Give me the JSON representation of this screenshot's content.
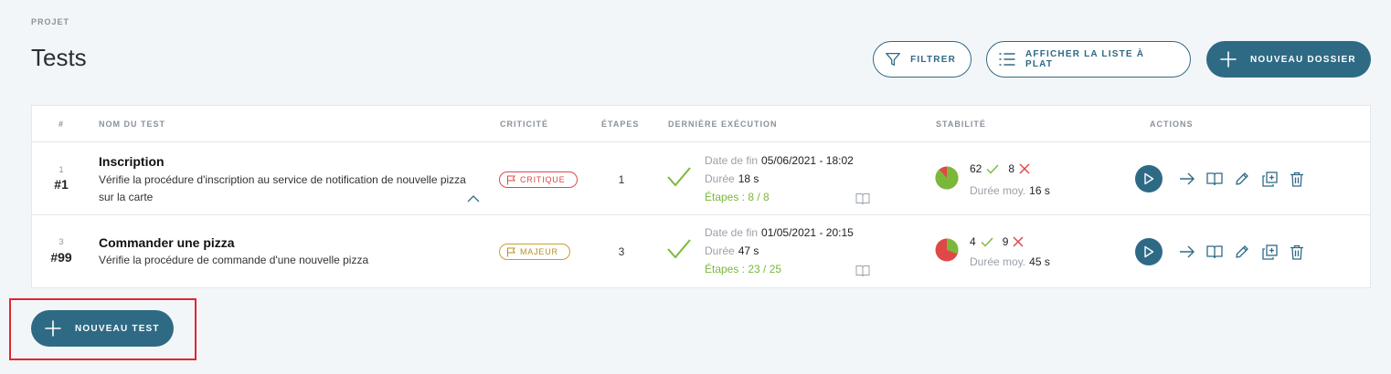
{
  "breadcrumb": "PROJET",
  "title": "Tests",
  "toolbar": {
    "filter_label": "FILTRER",
    "flat_label": "AFFICHER LA LISTE À PLAT",
    "new_folder_label": "NOUVEAU DOSSIER"
  },
  "table": {
    "headers": {
      "index": "#",
      "name": "NOM DU TEST",
      "criticality": "CRITICITÉ",
      "steps": "ÉTAPES",
      "last_execution": "DERNIÈRE EXÉCUTION",
      "stability": "STABILITÉ",
      "actions": "ACTIONS"
    },
    "rows": [
      {
        "index": "1",
        "number": "#1",
        "name": "Inscription",
        "description": "Vérifie la procédure d'inscription au service de notification de nouvelle pizza sur la carte",
        "criticality": "CRITIQUE",
        "steps": "1",
        "end_label": "Date de fin",
        "end_value": "05/06/2021 - 18:02",
        "duration_label": "Durée",
        "duration_value": "18 s",
        "steps_result": "Étapes : 8 / 8",
        "success_count": "62",
        "fail_count": "8",
        "avg_label": "Durée moy.",
        "avg_value": "16 s",
        "success_ratio": 0.886
      },
      {
        "index": "3",
        "number": "#99",
        "name": "Commander une pizza",
        "description": "Vérifie la procédure de commande d'une nouvelle pizza",
        "criticality": "MAJEUR",
        "steps": "3",
        "end_label": "Date de fin",
        "end_value": "01/05/2021 - 20:15",
        "duration_label": "Durée",
        "duration_value": "47 s",
        "steps_result": "Étapes : 23 / 25",
        "success_count": "4",
        "fail_count": "9",
        "avg_label": "Durée moy.",
        "avg_value": "45 s",
        "success_ratio": 0.308
      }
    ]
  },
  "new_test_label": "NOUVEAU TEST",
  "colors": {
    "primary": "#2f6a85",
    "success": "#7ab83a",
    "danger": "#e04848",
    "major": "#c8a02c",
    "highlight": "#e0262e"
  }
}
